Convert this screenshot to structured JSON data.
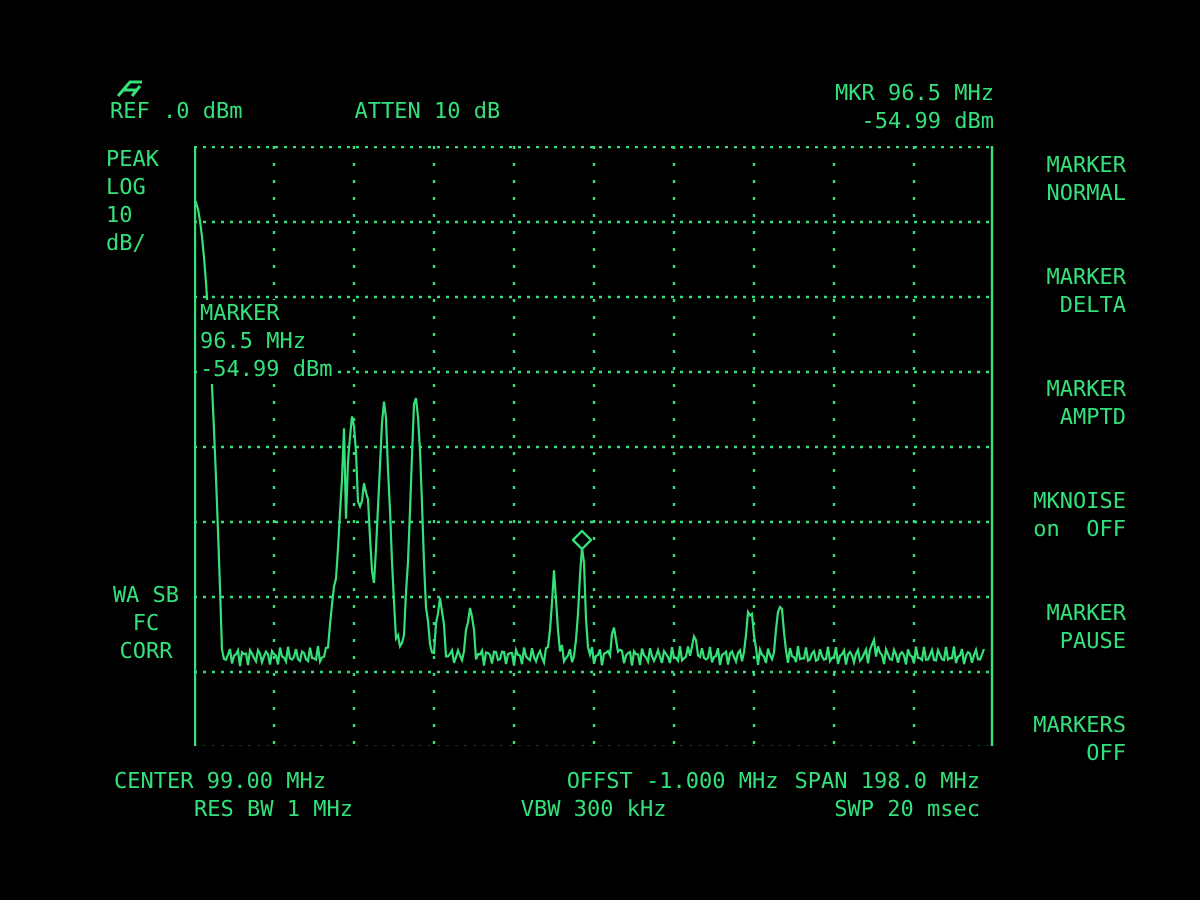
{
  "header": {
    "ref": "REF .0 dBm",
    "atten": "ATTEN 10 dB",
    "marker_freq": "MKR 96.5 MHz",
    "marker_level": "-54.99 dBm"
  },
  "scale_labels": [
    "PEAK",
    "LOG",
    "10",
    "dB/"
  ],
  "correction_labels": [
    "WA SB",
    "FC",
    "CORR"
  ],
  "marker_readout": [
    "MARKER",
    "96.5 MHz",
    "-54.99 dBm"
  ],
  "softkeys": [
    {
      "lines": [
        "MARKER",
        "NORMAL"
      ]
    },
    {
      "lines": [
        "MARKER",
        "DELTA"
      ]
    },
    {
      "lines": [
        "MARKER",
        "AMPTD"
      ]
    },
    {
      "lines": [
        "MKNOISE",
        "on  OFF"
      ]
    },
    {
      "lines": [
        "MARKER",
        "PAUSE"
      ]
    },
    {
      "lines": [
        "MARKERS",
        "OFF"
      ]
    }
  ],
  "footer": {
    "row_1": [
      "CENTER 99.00 MHz",
      "OFFST -1.000 MHz",
      "SPAN 198.0 MHz"
    ],
    "row_2": [
      "RES BW 1 MHz",
      "VBW 300 kHz",
      "SWP 20 msec"
    ]
  }
}
